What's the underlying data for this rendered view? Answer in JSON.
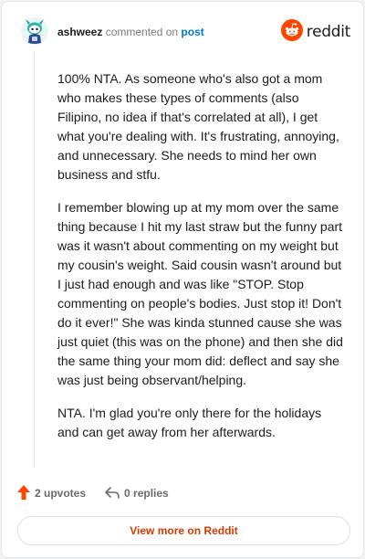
{
  "header": {
    "username": "ashweez",
    "action": " commented on ",
    "target": "post",
    "brand": "reddit"
  },
  "comment": {
    "paragraphs": [
      "100% NTA. As someone who's also got a mom who makes these types of comments (also Filipino, no idea if that's correlated at all), I get what you're dealing with. It's frustrating, annoying, and unnecessary. She needs to mind her own business and stfu.",
      "I remember blowing up at my mom over the same thing because I hit my last straw but the funny part was it wasn't about commenting on my weight but my cousin's weight. Said cousin wasn't around but I just had enough and was like \"STOP. Stop commenting on people's bodies. Just stop it! Don't do it ever!\" She was kinda stunned cause she was just quiet (this was on the phone) and then she did the same thing your mom did: deflect and say she was just being observant/helping.",
      "NTA. I'm glad you're only there for the holidays and can get away from her afterwards."
    ]
  },
  "footer": {
    "upvotes": "2 upvotes",
    "replies": "0 replies"
  },
  "view_more": "View more on Reddit",
  "colors": {
    "upvote": "#ff4500",
    "link": "#0079d3",
    "view_more": "#d93a00"
  },
  "icons": {
    "avatar": "snoo-avatar-icon",
    "brand": "reddit-logo-icon",
    "upvote": "upvote-arrow-icon",
    "reply": "reply-arrow-icon"
  }
}
